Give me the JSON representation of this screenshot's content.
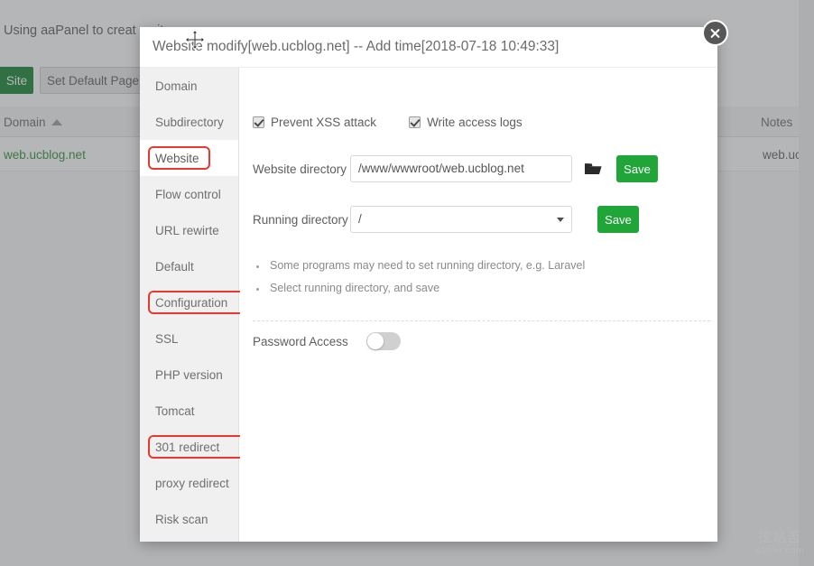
{
  "background": {
    "heading": "Using aaPanel to creat a sit",
    "site_button": "Site",
    "default_page_button": "Set Default Page",
    "table": {
      "columns": [
        "Domain",
        "Notes"
      ],
      "rows": [
        {
          "domain": "web.ucblog.net",
          "notes": "web.ucbl"
        }
      ],
      "sort_column": "Domain",
      "sort_direction": "asc"
    }
  },
  "modal": {
    "title": "Website modify[web.ucblog.net] -- Add time[2018-07-18 10:49:33]",
    "close_label": "close-icon",
    "sidebar": {
      "items": [
        {
          "label": "Domain",
          "active": false,
          "annotated": false
        },
        {
          "label": "Subdirectory",
          "active": false,
          "annotated": false
        },
        {
          "label": "Website",
          "active": true,
          "annotated": true
        },
        {
          "label": "Flow control",
          "active": false,
          "annotated": false
        },
        {
          "label": "URL rewirte",
          "active": false,
          "annotated": false
        },
        {
          "label": "Default",
          "active": false,
          "annotated": false
        },
        {
          "label": "Configuration",
          "active": false,
          "annotated": true
        },
        {
          "label": "SSL",
          "active": false,
          "annotated": false
        },
        {
          "label": "PHP version",
          "active": false,
          "annotated": false
        },
        {
          "label": "Tomcat",
          "active": false,
          "annotated": false
        },
        {
          "label": "301 redirect",
          "active": false,
          "annotated": true
        },
        {
          "label": "proxy redirect",
          "active": false,
          "annotated": false
        },
        {
          "label": "Risk scan",
          "active": false,
          "annotated": false
        }
      ]
    },
    "content": {
      "checkboxes": [
        {
          "label": "Prevent XSS attack",
          "checked": true
        },
        {
          "label": "Write access logs",
          "checked": true
        }
      ],
      "website_directory": {
        "label": "Website directory",
        "value": "/www/wwwroot/web.ucblog.net",
        "placeholder": "",
        "browse_icon": "folder-icon",
        "save_label": "Save"
      },
      "running_directory": {
        "label": "Running directory",
        "value": "/",
        "options": [
          "/"
        ],
        "save_label": "Save"
      },
      "tips": [
        "Some programs may need to set running directory, e.g. Laravel",
        "Select running directory, and save"
      ],
      "password_access": {
        "label": "Password Access",
        "enabled": false
      }
    }
  },
  "watermark": {
    "cn": "挖站否",
    "en": "wzfou.com"
  },
  "colors": {
    "accent_green": "#1fa538",
    "annotation_red": "#e8382f",
    "link_green": "#3f9b46"
  }
}
